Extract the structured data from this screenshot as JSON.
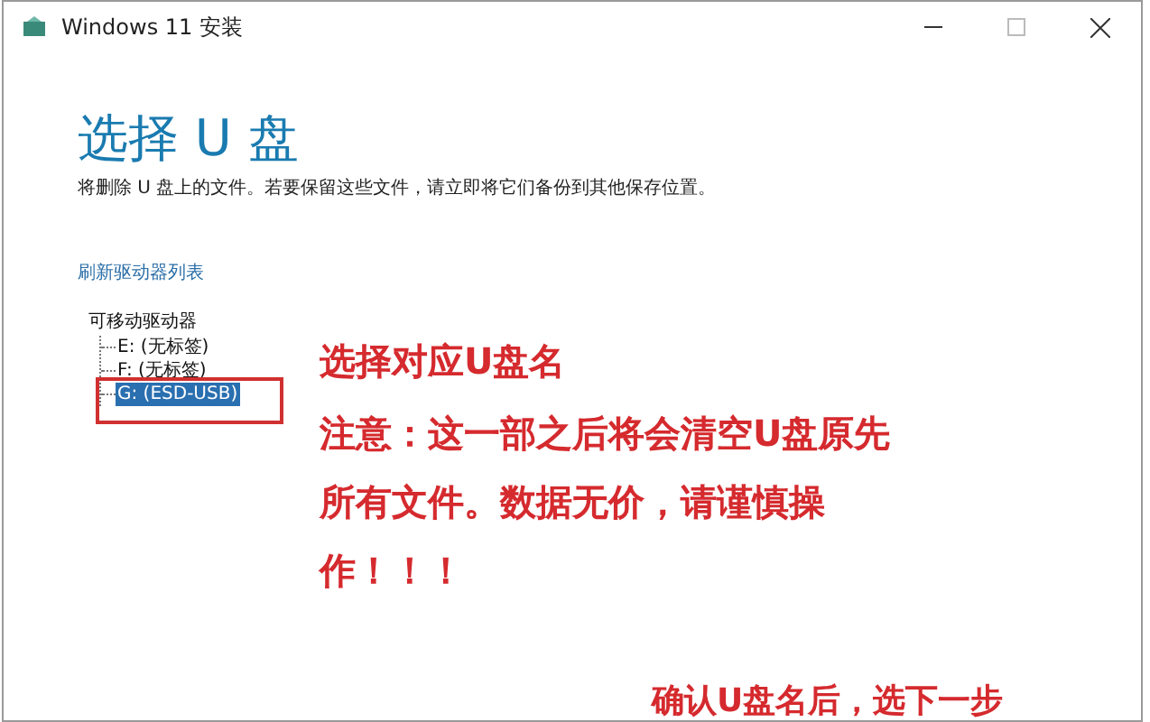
{
  "window": {
    "title": "Windows 11 安装"
  },
  "heading": "选择 U 盘",
  "description": "将删除 U 盘上的文件。若要保留这些文件，请立即将它们备份到其他保存位置。",
  "refresh_link": "刷新驱动器列表",
  "drive_tree": {
    "label": "可移动驱动器",
    "children": [
      {
        "label": "E: (无标签)",
        "selected": false
      },
      {
        "label": "F: (无标签)",
        "selected": false
      },
      {
        "label": "G: (ESD-USB)",
        "selected": true
      }
    ]
  },
  "annotations": [
    "选择对应U盘名",
    "注意：这一部之后将会清空U盘原先所有文件。数据无价，请谨慎操作！！！",
    "确认U盘名后，选下一步"
  ]
}
